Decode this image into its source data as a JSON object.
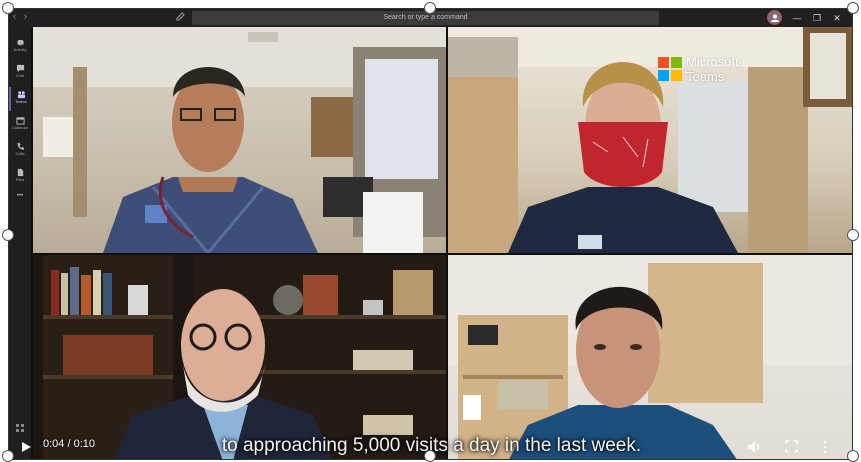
{
  "titlebar": {
    "back_glyph": "‹",
    "forward_glyph": "›",
    "search_placeholder": "Search or type a command",
    "minimize_glyph": "—",
    "restore_glyph": "❐",
    "close_glyph": "✕"
  },
  "rail": {
    "items": [
      {
        "label": "Activity",
        "icon": "bell-icon"
      },
      {
        "label": "Chat",
        "icon": "chat-icon"
      },
      {
        "label": "Teams",
        "icon": "teams-icon"
      },
      {
        "label": "Calendar",
        "icon": "calendar-icon"
      },
      {
        "label": "Calls",
        "icon": "phone-icon"
      },
      {
        "label": "Files",
        "icon": "file-icon"
      }
    ],
    "more_glyph": "•••"
  },
  "watermark": {
    "line1": "Microsoft",
    "line2": "Teams",
    "colors": [
      "#f25022",
      "#7fba00",
      "#00a4ef",
      "#ffb900"
    ]
  },
  "player": {
    "caption": "to approaching 5,000 visits a day in the last week.",
    "current_time": "0:04",
    "duration": "0:10",
    "time_display": "0:04 / 0:10"
  },
  "colors": {
    "teams_accent": "#6264a7",
    "rail_bg": "#1f1f1f",
    "titlebar_bg": "#202020"
  }
}
